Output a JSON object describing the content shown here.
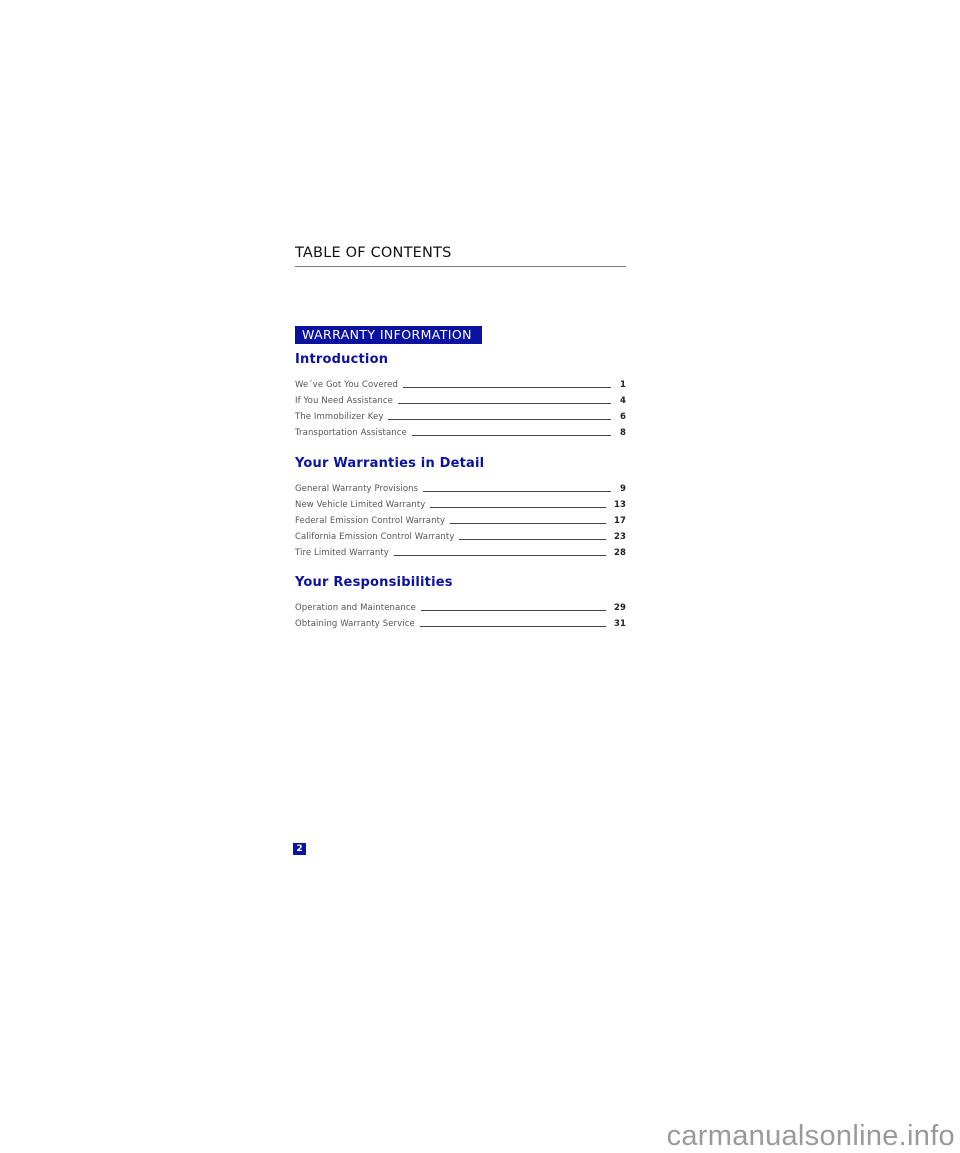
{
  "header": {
    "title": "TABLE OF CONTENTS"
  },
  "banner": {
    "label": "WARRANTY INFORMATION",
    "color": "#0b12a0"
  },
  "sections": [
    {
      "title": "Introduction",
      "items": [
        {
          "label": "We´ve Got You Covered",
          "page": "1"
        },
        {
          "label": "If You Need Assistance",
          "page": "4"
        },
        {
          "label": "The Immobilizer Key",
          "page": "6"
        },
        {
          "label": "Transportation Assistance",
          "page": "8"
        }
      ]
    },
    {
      "title": "Your Warranties in Detail",
      "items": [
        {
          "label": "General Warranty Provisions",
          "page": "9"
        },
        {
          "label": "New Vehicle Limited Warranty",
          "page": "13"
        },
        {
          "label": "Federal Emission Control Warranty",
          "page": "17"
        },
        {
          "label": "California Emission Control Warranty",
          "page": "23"
        },
        {
          "label": "Tire Limited Warranty",
          "page": "28"
        }
      ]
    },
    {
      "title": "Your Responsibilities",
      "items": [
        {
          "label": "Operation and Maintenance",
          "page": "29"
        },
        {
          "label": "Obtaining Warranty Service",
          "page": "31"
        }
      ]
    }
  ],
  "footer": {
    "page_number": "2",
    "watermark": "carmanualsonline.info"
  }
}
